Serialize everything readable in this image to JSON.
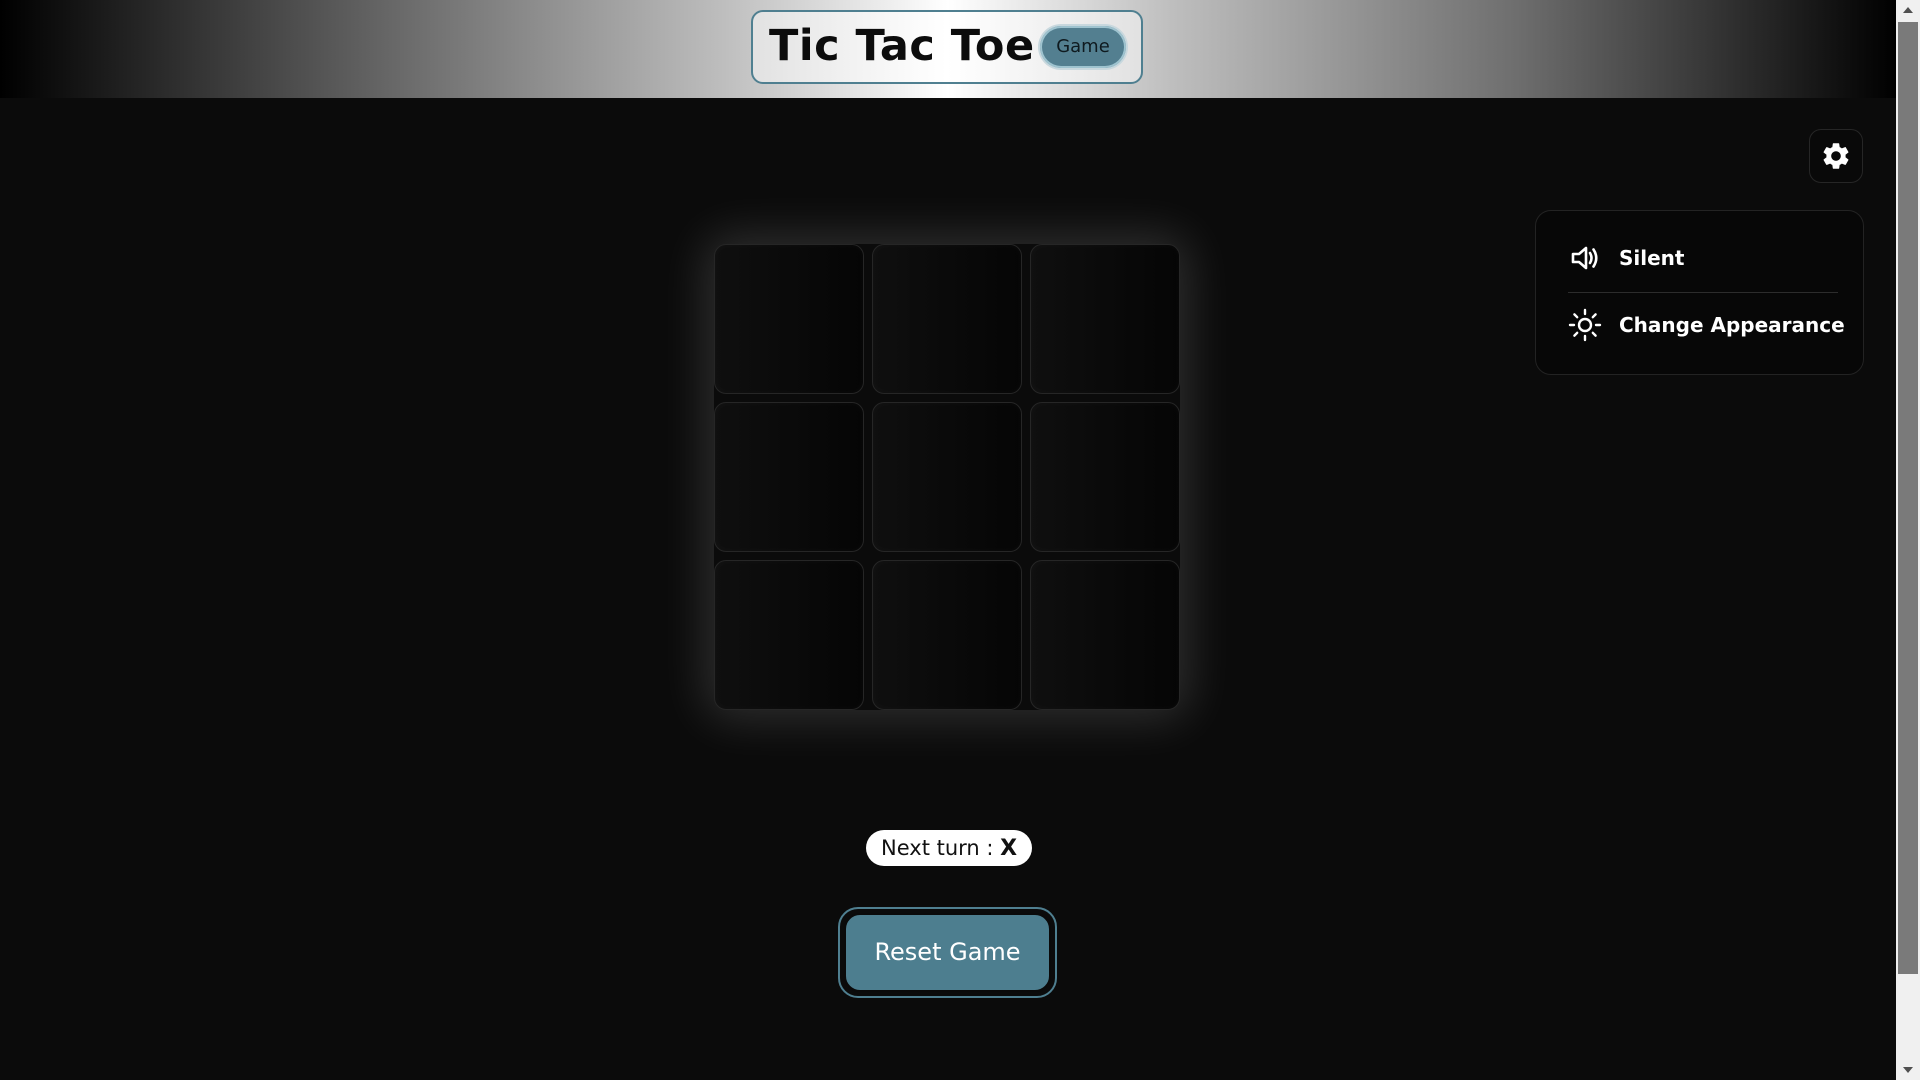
{
  "header": {
    "title": "Tic Tac Toe",
    "badge": "Game"
  },
  "settings": {
    "icon": "gear-icon",
    "menu": [
      {
        "label": "Silent",
        "icon": "speaker-icon"
      },
      {
        "label": "Change Appearance",
        "icon": "sun-icon"
      }
    ]
  },
  "board": {
    "cells": [
      "",
      "",
      "",
      "",
      "",
      "",
      "",
      "",
      ""
    ]
  },
  "status": {
    "prefix": "Next turn : ",
    "next_player": "X"
  },
  "reset_label": "Reset Game",
  "colors": {
    "accent": "#4d7e8f",
    "background": "#0b0b0b"
  }
}
